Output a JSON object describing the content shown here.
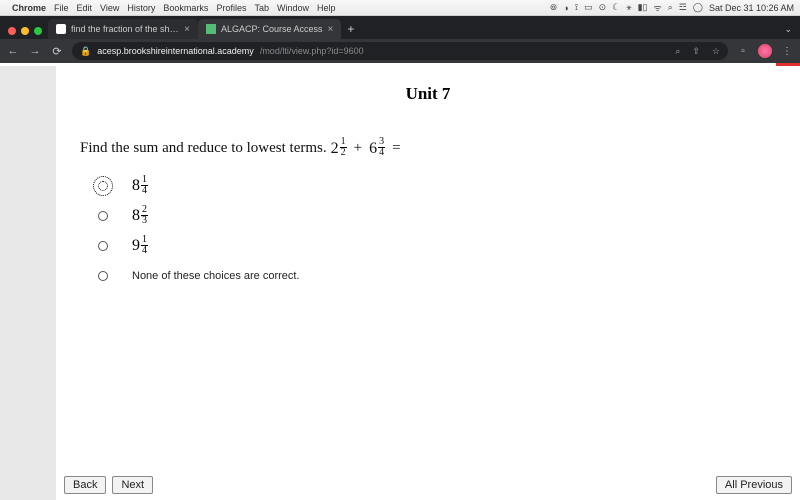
{
  "macbar": {
    "app": "Chrome",
    "menus": [
      "File",
      "Edit",
      "View",
      "History",
      "Bookmarks",
      "Profiles",
      "Tab",
      "Window",
      "Help"
    ],
    "clock": "Sat Dec 31 10:26 AM"
  },
  "browser": {
    "tabs": [
      {
        "title": "find the fraction of the shaded",
        "active": false
      },
      {
        "title": "ALGACP: Course Access",
        "active": true
      }
    ],
    "url_host": "acesp.brookshireinternational.academy",
    "url_path": "/mod/lti/view.php?id=9600"
  },
  "quiz": {
    "unit_title": "Unit 7",
    "question_stem": "Find the sum and reduce to lowest terms.  ",
    "expr": {
      "a_whole": "2",
      "a_num": "1",
      "a_den": "2",
      "plus": "+",
      "b_whole": "6",
      "b_num": "3",
      "b_den": "4",
      "eq": "="
    },
    "choices": [
      {
        "type": "mixed",
        "whole": "8",
        "num": "1",
        "den": "4",
        "selected": true
      },
      {
        "type": "mixed",
        "whole": "8",
        "num": "2",
        "den": "3",
        "selected": false
      },
      {
        "type": "mixed",
        "whole": "9",
        "num": "1",
        "den": "4",
        "selected": false
      },
      {
        "type": "text",
        "text": "None of these choices are correct.",
        "selected": false
      }
    ],
    "buttons": {
      "back": "Back",
      "next": "Next",
      "all_prev": "All Previous"
    }
  }
}
